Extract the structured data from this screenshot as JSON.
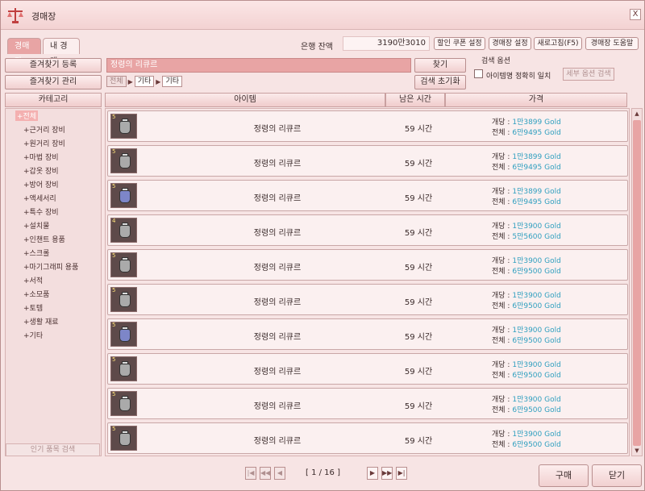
{
  "window": {
    "title": "경매장",
    "close": "X"
  },
  "tabs": [
    {
      "label": "경매장"
    },
    {
      "label": "내 경매"
    }
  ],
  "bank": {
    "label": "은행 잔액",
    "value": "3190만3010"
  },
  "top_buttons": [
    {
      "label": "할인 쿠폰 설정"
    },
    {
      "label": "경매장 설정"
    },
    {
      "label": "새로고침(F5)"
    },
    {
      "label": "경매장 도움말"
    }
  ],
  "left_buttons": {
    "add_favorite": "즐겨찾기 등록",
    "manage_favorite": "즐겨찾기 관리"
  },
  "search": {
    "value": "정령의 리큐르",
    "find": "찾기",
    "reset": "검색 초기화"
  },
  "breadcrumb": [
    "전체",
    "기타",
    "기타"
  ],
  "search_options": {
    "title": "검색 옵션",
    "exact_label": "아이템명 정확히 일치",
    "detail_btn": "세부 옵션 검색"
  },
  "columns": {
    "category": "카테고리",
    "item": "아이템",
    "time": "남은 시간",
    "price": "가격"
  },
  "categories": [
    "+전체",
    "+근거리 장비",
    "+원거리 장비",
    "+마법 장비",
    "+갑옷 장비",
    "+방어 장비",
    "+액세서리",
    "+특수 장비",
    "+설치물",
    "+인챈트 용품",
    "+스크롤",
    "+마기그래피 용품",
    "+서적",
    "+소모품",
    "+토템",
    "+생활 재료",
    "+기타"
  ],
  "popular_search": "인기 품목 검색",
  "rows": [
    {
      "level": "5",
      "name": "정령의 리큐르",
      "time": "59 시간",
      "unit_label": "개당 :",
      "unit": "1만3899 Gold",
      "total_label": "전체 :",
      "total": "6만9495 Gold",
      "blue": false
    },
    {
      "level": "5",
      "name": "정령의 리큐르",
      "time": "59 시간",
      "unit_label": "개당 :",
      "unit": "1만3899 Gold",
      "total_label": "전체 :",
      "total": "6만9495 Gold",
      "blue": false
    },
    {
      "level": "5",
      "name": "정령의 리큐르",
      "time": "59 시간",
      "unit_label": "개당 :",
      "unit": "1만3899 Gold",
      "total_label": "전체 :",
      "total": "6만9495 Gold",
      "blue": true
    },
    {
      "level": "4",
      "name": "정령의 리큐르",
      "time": "59 시간",
      "unit_label": "개당 :",
      "unit": "1만3900 Gold",
      "total_label": "전체 :",
      "total": "5만5600 Gold",
      "blue": false
    },
    {
      "level": "5",
      "name": "정령의 리큐르",
      "time": "59 시간",
      "unit_label": "개당 :",
      "unit": "1만3900 Gold",
      "total_label": "전체 :",
      "total": "6만9500 Gold",
      "blue": false
    },
    {
      "level": "5",
      "name": "정령의 리큐르",
      "time": "59 시간",
      "unit_label": "개당 :",
      "unit": "1만3900 Gold",
      "total_label": "전체 :",
      "total": "6만9500 Gold",
      "blue": false
    },
    {
      "level": "5",
      "name": "정령의 리큐르",
      "time": "59 시간",
      "unit_label": "개당 :",
      "unit": "1만3900 Gold",
      "total_label": "전체 :",
      "total": "6만9500 Gold",
      "blue": true
    },
    {
      "level": "5",
      "name": "정령의 리큐르",
      "time": "59 시간",
      "unit_label": "개당 :",
      "unit": "1만3900 Gold",
      "total_label": "전체 :",
      "total": "6만9500 Gold",
      "blue": false
    },
    {
      "level": "5",
      "name": "정령의 리큐르",
      "time": "59 시간",
      "unit_label": "개당 :",
      "unit": "1만3900 Gold",
      "total_label": "전체 :",
      "total": "6만9500 Gold",
      "blue": false
    },
    {
      "level": "5",
      "name": "정령의 리큐르",
      "time": "59 시간",
      "unit_label": "개당 :",
      "unit": "1만3900 Gold",
      "total_label": "전체 :",
      "total": "6만9500 Gold",
      "blue": false
    }
  ],
  "pagination": {
    "text": "[ 1 / 16 ]"
  },
  "actions": {
    "buy": "구매",
    "close": "닫기"
  },
  "colors": {
    "accent": "#e8a4a4",
    "gold_text": "#2f9fbf",
    "background": "#f7e4e4"
  },
  "icons": {
    "title": "scale-icon",
    "item": "liqueur-bottle-icon"
  }
}
